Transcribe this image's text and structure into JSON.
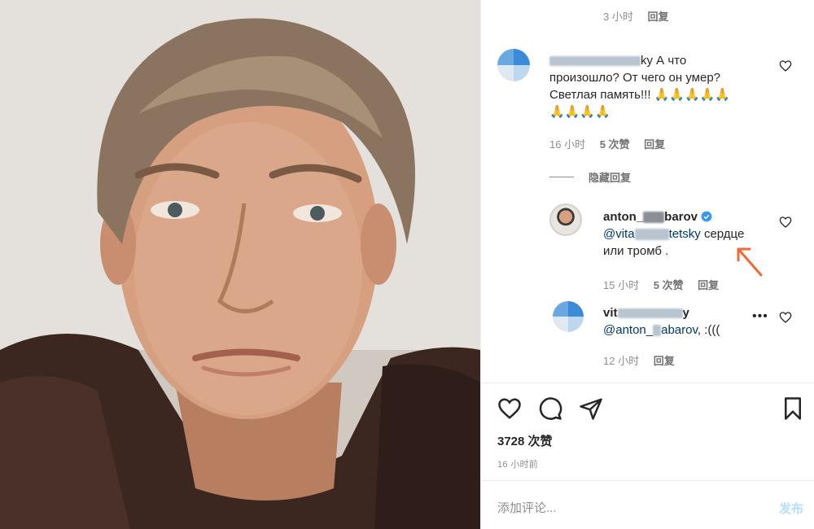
{
  "comments": {
    "top_meta": {
      "time": "3 小时",
      "reply": "回复"
    },
    "c1": {
      "username_visible": "ky",
      "text_line1": "А что",
      "text_line2": "произошло? От чего он умер?",
      "text_line3": "Светлая память!!! 🙏🙏🙏🙏🙏",
      "text_line4": "🙏🙏🙏🙏",
      "time": "16 小时",
      "likes": "5 次赞",
      "reply": "回复"
    },
    "hide_replies": "隐藏回复",
    "r1": {
      "username_prefix": "anton_",
      "username_suffix": "barov",
      "mention_prefix": "@vita",
      "mention_suffix": "tetsky",
      "text_tail": "сердце",
      "text_line2": "или тромб .",
      "time": "15 小时",
      "likes": "5 次赞",
      "reply": "回复"
    },
    "r2": {
      "username_prefix": "vit",
      "username_suffix": "y",
      "mention_prefix": "@anton_",
      "mention_suffix": "abarov,",
      "text_tail": ":(((",
      "time": "12 小时",
      "reply": "回复"
    }
  },
  "actions": {
    "likes": "3728 次赞",
    "posted": "16 小时前"
  },
  "add_comment": {
    "placeholder": "添加评论...",
    "post": "发布"
  },
  "colors": {
    "accent_disabled": "#b2dffc",
    "mention": "#00376b",
    "verified": "#3897f0",
    "arrow": "#f06a35"
  }
}
